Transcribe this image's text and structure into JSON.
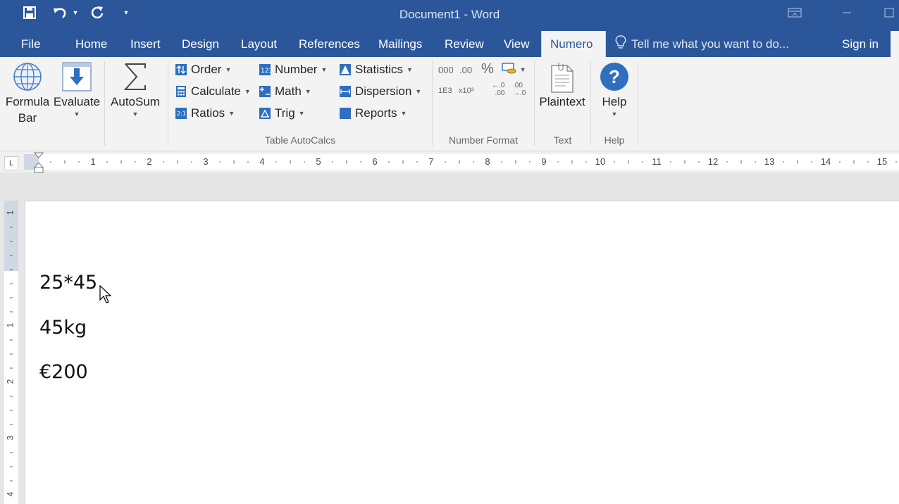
{
  "window": {
    "title": "Document1 - Word"
  },
  "quick_access": {
    "icons": [
      "save-icon",
      "undo-icon",
      "redo-icon",
      "customize-icon"
    ]
  },
  "tabs": [
    {
      "label": "File"
    },
    {
      "label": "Home"
    },
    {
      "label": "Insert"
    },
    {
      "label": "Design"
    },
    {
      "label": "Layout"
    },
    {
      "label": "References"
    },
    {
      "label": "Mailings"
    },
    {
      "label": "Review"
    },
    {
      "label": "View"
    },
    {
      "label": "Numero",
      "active": true
    }
  ],
  "tell_me": {
    "placeholder": "Tell me what you want to do..."
  },
  "account": {
    "sign_in": "Sign in"
  },
  "ribbon": {
    "formula_bar": {
      "line1": "Formula",
      "line2": "Bar"
    },
    "evaluate": {
      "label": "Evaluate"
    },
    "autosum": {
      "label": "AutoSum"
    },
    "order": {
      "label": "Order"
    },
    "calculate": {
      "label": "Calculate"
    },
    "ratios": {
      "label": "Ratios"
    },
    "number": {
      "label": "Number"
    },
    "math": {
      "label": "Math"
    },
    "trig": {
      "label": "Trig"
    },
    "statistics": {
      "label": "Statistics"
    },
    "dispersion": {
      "label": "Dispersion"
    },
    "reports": {
      "label": "Reports"
    },
    "number_format": {
      "thousands": "000",
      "decimals": ".00",
      "percent": "%",
      "scientific": "1E3",
      "power": "x10³",
      "decrease_decimal_top": ".0",
      "decrease_decimal_bottom": ".00",
      "increase_decimal_top": ".00",
      "increase_decimal_bottom": ".0"
    },
    "plaintext": {
      "label": "Plaintext"
    },
    "help": {
      "label": "Help"
    },
    "groups": {
      "table_autocalcs": "Table AutoCalcs",
      "number_format": "Number Format",
      "text": "Text",
      "help": "Help"
    }
  },
  "ruler": {
    "horizontal_numbers": [
      "1",
      "2",
      "3",
      "4",
      "5",
      "6",
      "7",
      "8",
      "9",
      "10",
      "11",
      "12",
      "13",
      "14",
      "15"
    ],
    "vertical_numbers": [
      "1",
      "1",
      "2",
      "3",
      "4"
    ],
    "corner": "L"
  },
  "document": {
    "lines": [
      "25*45",
      "45kg",
      "€200"
    ]
  },
  "colors": {
    "titlebar": "#2b579a",
    "ribbon": "#f3f3f3",
    "accent": "#2b579a"
  }
}
